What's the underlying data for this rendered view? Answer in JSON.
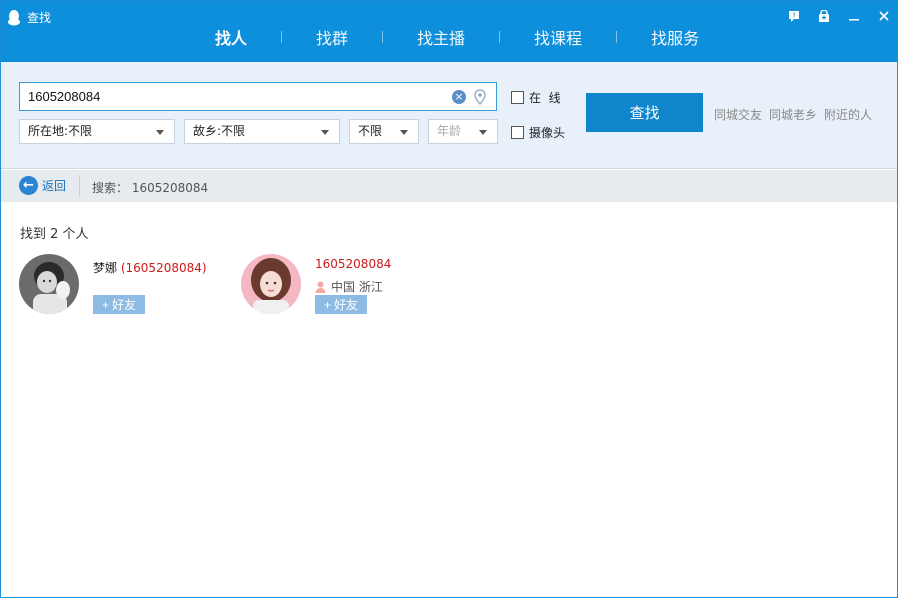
{
  "window": {
    "title": "查找"
  },
  "tabs": [
    {
      "label": "找人",
      "active": true
    },
    {
      "label": "找群"
    },
    {
      "label": "找主播"
    },
    {
      "label": "找课程"
    },
    {
      "label": "找服务"
    }
  ],
  "search": {
    "value": "1605208084",
    "location": "所在地:不限",
    "hometown": "故乡:不限",
    "gender": "不限",
    "age_placeholder": "年龄",
    "online_label": "在  线",
    "camera_label": "摄像头",
    "button": "查找",
    "quick_links": [
      "同城交友",
      "同城老乡",
      "附近的人"
    ]
  },
  "breadcrumb": {
    "back": "返回",
    "query": "搜索： 1605208084"
  },
  "results": {
    "count_text": "找到 2 个人",
    "people": [
      {
        "name": "梦娜",
        "id": "(1605208084)",
        "add": "好友"
      },
      {
        "id": "1605208084",
        "location": "中国 浙江",
        "add": "好友"
      }
    ]
  },
  "colors": {
    "titlebar": "#0d8fdb",
    "panel": "#e8f1fa",
    "button": "#0f86cc",
    "id_red": "#cc1a1a"
  }
}
